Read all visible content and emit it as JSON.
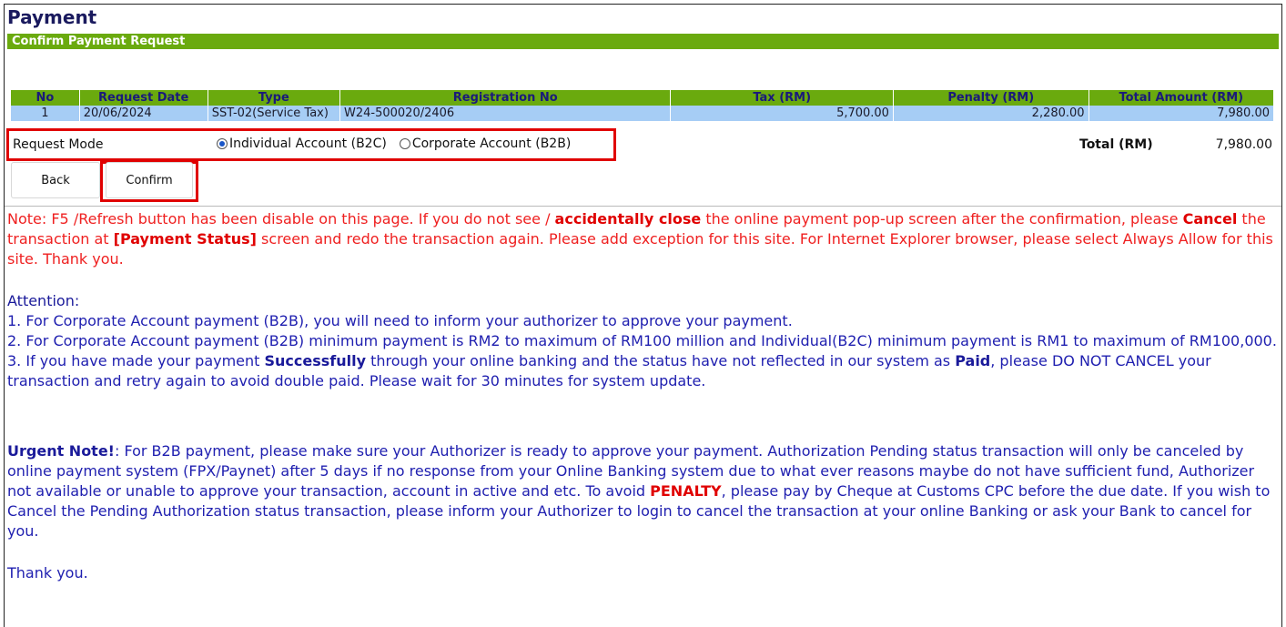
{
  "page": {
    "title": "Payment",
    "subtitle": "Confirm Payment Request"
  },
  "table": {
    "headers": [
      "No",
      "Request Date",
      "Type",
      "Registration No",
      "Tax (RM)",
      "Penalty (RM)",
      "Total Amount (RM)"
    ],
    "rows": [
      {
        "no": "1",
        "date": "20/06/2024",
        "type": "SST-02(Service Tax)",
        "reg": "W24-500020/2406",
        "tax": "5,700.00",
        "penalty": "2,280.00",
        "total": "7,980.00"
      }
    ]
  },
  "request_mode": {
    "label": "Request Mode",
    "option_individual": "Individual Account (B2C)",
    "option_corporate": "Corporate Account (B2B)",
    "selected": "individual"
  },
  "totals": {
    "label": "Total (RM)",
    "value": "7,980.00"
  },
  "buttons": {
    "back": "Back",
    "confirm": "Confirm"
  },
  "note": {
    "p1": "Note: F5 /Refresh button has been disable on this page. If you do not see / ",
    "b1": "accidentally close",
    "p2": " the online payment pop-up screen after the confirmation, please ",
    "b2": "Cancel",
    "p3": " the transaction at ",
    "b3": "[Payment Status]",
    "p4": " screen and redo the transaction again. Please add exception for this site. For Internet Explorer browser, please select Always Allow for this site. Thank you."
  },
  "attention": {
    "head": "Attention:",
    "l1": "1. For Corporate Account payment (B2B), you will need to inform your authorizer to approve your payment.",
    "l2": "2. For Corporate Account payment (B2B) minimum payment is RM2 to maximum of RM100 million and Individual(B2C) minimum payment is RM1 to maximum of RM100,000.",
    "l3a": "3. If you have made your payment ",
    "l3b": "Successfully",
    "l3c": " through your online banking and the status have not reflected in our system as ",
    "l3d": "Paid",
    "l3e": ", please DO NOT CANCEL your transaction and retry again to avoid double paid. Please wait for 30 minutes for system update."
  },
  "urgent": {
    "head": "Urgent Note!",
    "t1": ": For B2B payment, please make sure your Authorizer is ready to approve your payment. Authorization Pending status transaction will only be canceled by online payment system (FPX/Paynet) after 5 days if no response from your Online Banking system due to what ever reasons maybe do not have sufficient fund, Authorizer not available or unable to approve your transaction, account in active and etc. To avoid ",
    "penalty": "PENALTY",
    "t2": ", please pay by Cheque at Customs CPC before the due date. If you wish to Cancel the Pending Authorization status transaction, please inform your Authorizer to login to cancel the transaction at your online Banking or ask your Bank to cancel for you."
  },
  "thanks": "Thank you.",
  "colors": {
    "green": "#6aaa0e",
    "row_blue": "#a6cdf5",
    "red": "#e00000",
    "blue_text": "#2020b0"
  }
}
